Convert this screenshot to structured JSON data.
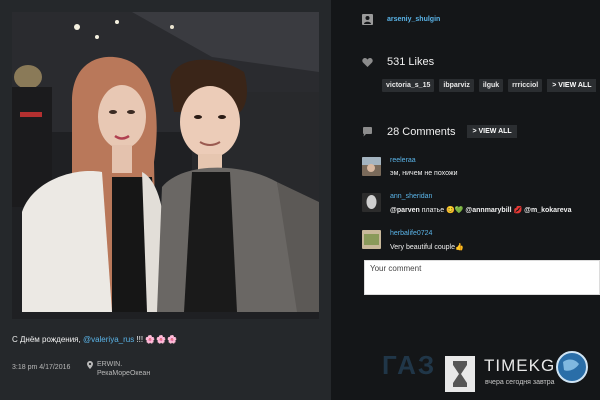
{
  "post": {
    "caption_prefix": "С Днём рождения, ",
    "caption_mention": "@valeriya_rus",
    "caption_suffix": " !!! ",
    "caption_emoji": "🌸🌸🌸",
    "time": "3:18 pm 4/17/2016",
    "location_line1": "ERWIN.",
    "location_line2": "РекаМореОкеан"
  },
  "sidebar": {
    "username": "arseniy_shulgin",
    "likes_label": "531 Likes",
    "likers": [
      "victoria_s_15",
      "ibparviz",
      "ilguk",
      "rrricciol"
    ],
    "likers_view_all": "> VIEW ALL",
    "comments_label": "28 Comments",
    "comments_view_all": "> VIEW ALL",
    "comments": [
      {
        "user": "reeleraa",
        "text": "эм, ничем не похожи"
      },
      {
        "user": "ann_sheridan",
        "mention1": "@parven",
        "text_mid": " платье 😊💚 ",
        "mention2": "@annmarybill",
        "text_mid2": " 💋 ",
        "mention3": "@m_kokareva"
      },
      {
        "user": "herbalife0724",
        "text": "Very beautiful couple👍"
      }
    ],
    "comment_placeholder": "Your comment"
  },
  "watermark": {
    "left_text": "ГАЗ",
    "title": "TIMEKG",
    "subtitle": "вчера сегодня завтра"
  },
  "colors": {
    "accent": "#5ab4e8",
    "background": "#141618",
    "card": "#25282b"
  },
  "icons": [
    "user-icon",
    "heart-icon",
    "comment-bubble-icon",
    "location-pin-icon",
    "hourglass-icon",
    "globe-icon"
  ]
}
